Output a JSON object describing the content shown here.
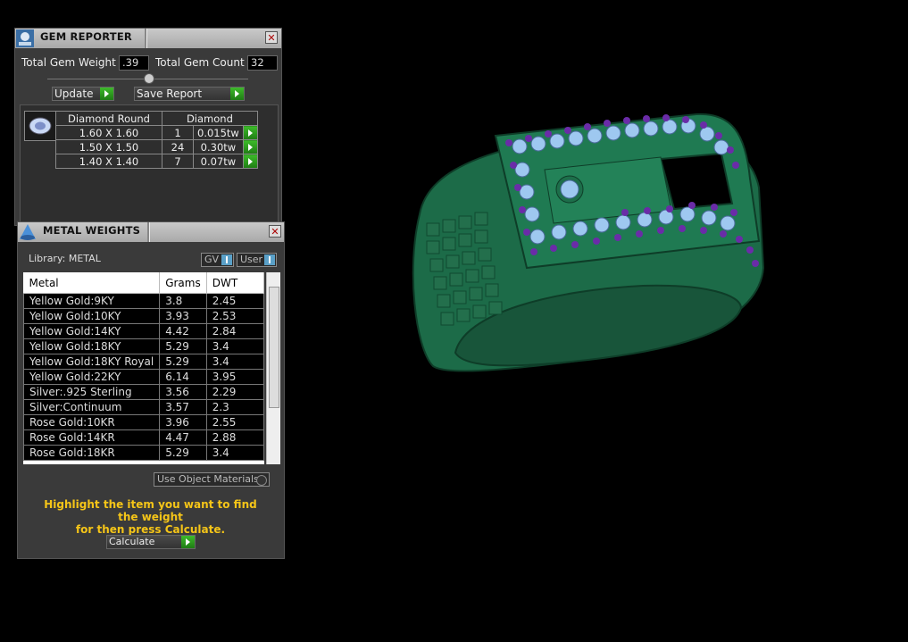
{
  "gem_reporter": {
    "title": "GEM REPORTER",
    "total_weight_label": "Total Gem Weight",
    "total_weight_value": ".39",
    "total_count_label": "Total Gem Count",
    "total_count_value": "32",
    "update_label": "Update",
    "save_report_label": "Save Report",
    "table_headers": [
      "Diamond Round",
      "Diamond"
    ],
    "rows": [
      {
        "size": "1.60 X 1.60",
        "count": "1",
        "weight": "0.015tw"
      },
      {
        "size": "1.50 X 1.50",
        "count": "24",
        "weight": "0.30tw"
      },
      {
        "size": "1.40 X 1.40",
        "count": "7",
        "weight": "0.07tw"
      }
    ]
  },
  "metal_weights": {
    "title": "METAL WEIGHTS",
    "library_label": "Library: METAL",
    "gv_label": "GV",
    "user_label": "User",
    "columns": [
      "Metal",
      "Grams",
      "DWT"
    ],
    "rows": [
      {
        "metal": "Yellow Gold:9KY",
        "grams": "3.8",
        "dwt": "2.45"
      },
      {
        "metal": "Yellow Gold:10KY",
        "grams": "3.93",
        "dwt": "2.53"
      },
      {
        "metal": "Yellow Gold:14KY",
        "grams": "4.42",
        "dwt": "2.84"
      },
      {
        "metal": "Yellow Gold:18KY",
        "grams": "5.29",
        "dwt": "3.4"
      },
      {
        "metal": "Yellow Gold:18KY Royal",
        "grams": "5.29",
        "dwt": "3.4"
      },
      {
        "metal": "Yellow Gold:22KY",
        "grams": "6.14",
        "dwt": "3.95"
      },
      {
        "metal": "Silver:.925 Sterling",
        "grams": "3.56",
        "dwt": "2.29"
      },
      {
        "metal": "Silver:Continuum",
        "grams": "3.57",
        "dwt": "2.3"
      },
      {
        "metal": "Rose Gold:10KR",
        "grams": "3.96",
        "dwt": "2.55"
      },
      {
        "metal": "Rose Gold:14KR",
        "grams": "4.47",
        "dwt": "2.88"
      },
      {
        "metal": "Rose Gold:18KR",
        "grams": "5.29",
        "dwt": "3.4"
      }
    ],
    "use_object_materials_label": "Use Object Materials",
    "hint_line1": "Highlight the item you want to find the weight",
    "hint_line2": "for then press Calculate.",
    "calculate_label": "Calculate"
  },
  "colors": {
    "ring_green": "#1f8a5a",
    "stone_blue": "#9ec8f0",
    "accent_purple": "#6a2ca8",
    "hint_yellow": "#f5c518",
    "button_green": "#2fa01f"
  }
}
